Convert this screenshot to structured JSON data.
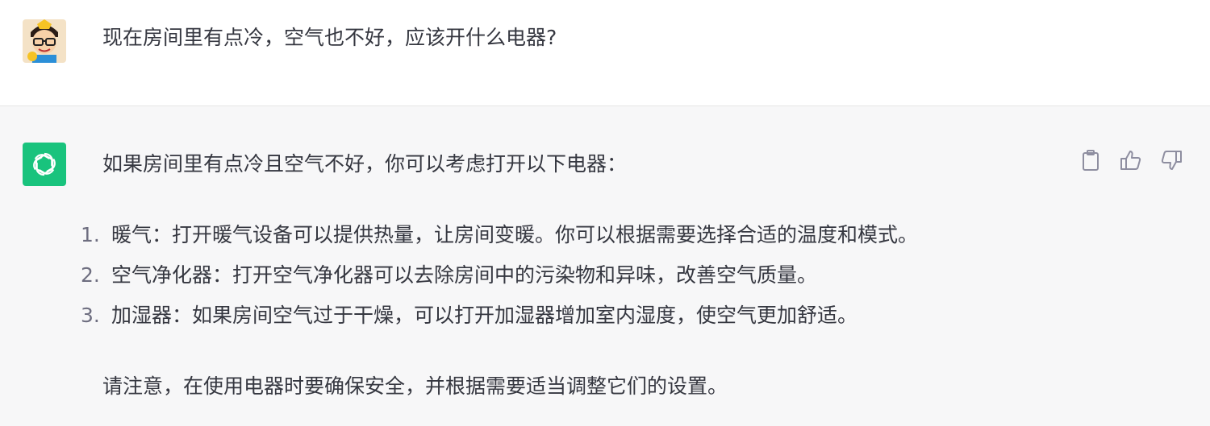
{
  "conversation": {
    "user": {
      "message": "现在房间里有点冷，空气也不好，应该开什么电器?"
    },
    "assistant": {
      "intro": "如果房间里有点冷且空气不好，你可以考虑打开以下电器：",
      "items": [
        {
          "num": "1.",
          "text": "暖气：打开暖气设备可以提供热量，让房间变暖。你可以根据需要选择合适的温度和模式。"
        },
        {
          "num": "2.",
          "text": "空气净化器：打开空气净化器可以去除房间中的污染物和异味，改善空气质量。"
        },
        {
          "num": "3.",
          "text": "加湿器：如果房间空气过于干燥，可以打开加湿器增加室内湿度，使空气更加舒适。"
        }
      ],
      "note": "请注意，在使用电器时要确保安全，并根据需要适当调整它们的设置。"
    }
  },
  "icons": {
    "copy": "clipboard-icon",
    "like": "thumbs-up-icon",
    "dislike": "thumbs-down-icon",
    "assistant_logo": "openai-logo-icon"
  },
  "colors": {
    "assistant_bg": "#f7f7f8",
    "assistant_logo_bg": "#19c37d",
    "text": "#353740",
    "icon": "#8e8ea0"
  }
}
